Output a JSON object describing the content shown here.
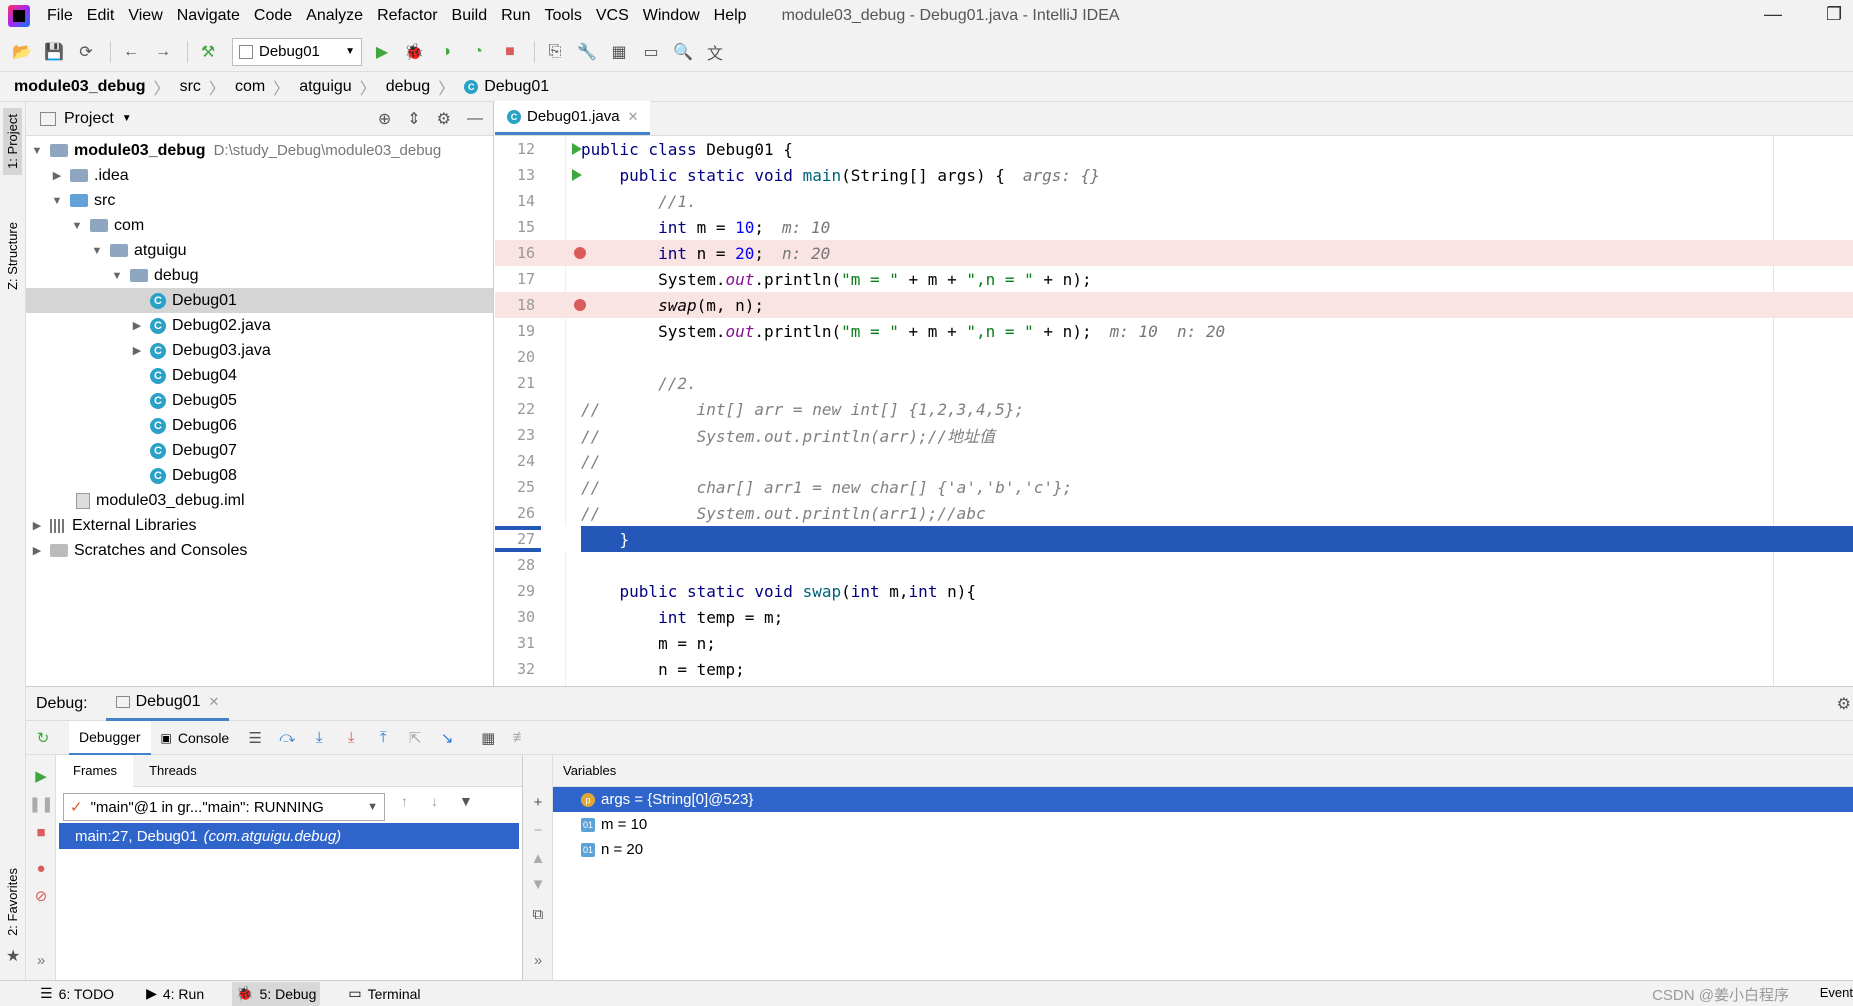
{
  "menubar": {
    "items": [
      "File",
      "Edit",
      "View",
      "Navigate",
      "Code",
      "Analyze",
      "Refactor",
      "Build",
      "Run",
      "Tools",
      "VCS",
      "Window",
      "Help"
    ],
    "title": "module03_debug - Debug01.java - IntelliJ IDEA"
  },
  "toolbar": {
    "run_config": "Debug01"
  },
  "breadcrumb": [
    "module03_debug",
    "src",
    "com",
    "atguigu",
    "debug",
    "Debug01"
  ],
  "left_strip": {
    "project_tab": "1: Project",
    "structure_tab": "Z: Structure",
    "favorites_tab": "2: Favorites"
  },
  "project": {
    "header": "Project",
    "root": "module03_debug",
    "root_path": "D:\\study_Debug\\module03_debug",
    "idea": ".idea",
    "src": "src",
    "com": "com",
    "atguigu": "atguigu",
    "debug": "debug",
    "files": [
      "Debug01",
      "Debug02.java",
      "Debug03.java",
      "Debug04",
      "Debug05",
      "Debug06",
      "Debug07",
      "Debug08"
    ],
    "iml": "module03_debug.iml",
    "ext_libs": "External Libraries",
    "scratches": "Scratches and Consoles"
  },
  "editor": {
    "tab_label": "Debug01.java",
    "line_numbers": [
      "12",
      "13",
      "14",
      "15",
      "16",
      "17",
      "18",
      "19",
      "20",
      "21",
      "22",
      "23",
      "24",
      "25",
      "26",
      "27",
      "28",
      "29",
      "30",
      "31",
      "32"
    ],
    "hints": {
      "args": "args: {}",
      "m": "m: 10",
      "n": "n: 20",
      "mn": "m: 10  n: 20"
    }
  },
  "debug": {
    "label": "Debug:",
    "tab": "Debug01",
    "debugger_tab": "Debugger",
    "console_tab": "Console",
    "frames_tab": "Frames",
    "threads_tab": "Threads",
    "thread_select": "\"main\"@1 in gr...\"main\": RUNNING",
    "frame_method": "main:27, Debug01",
    "frame_pkg": "(com.atguigu.debug)",
    "variables_header": "Variables",
    "variables": [
      {
        "icon": "p",
        "text": "args = {String[0]@523}"
      },
      {
        "icon": "01",
        "text": "m = 10"
      },
      {
        "icon": "01",
        "text": "n = 20"
      }
    ]
  },
  "statusbar": {
    "todo": "6: TODO",
    "run": "4: Run",
    "debug": "5: Debug",
    "terminal": "Terminal",
    "watermark": "CSDN @姜小白程序",
    "event_log": "Event"
  }
}
